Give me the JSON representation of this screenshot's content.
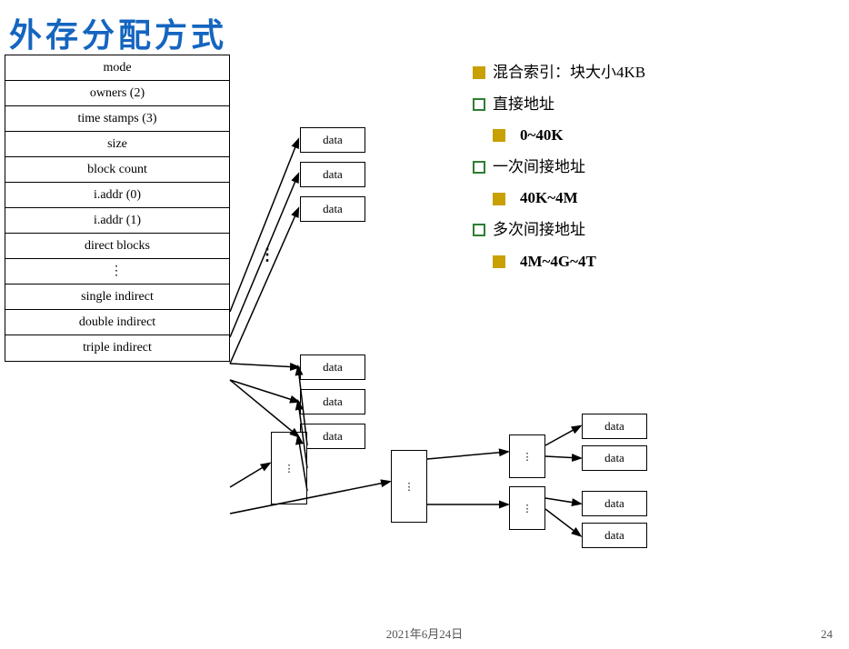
{
  "title": "外存分配方式",
  "inode_rows": [
    "mode",
    "owners (2)",
    "time stamps (3)",
    "size",
    "block count",
    "i.addr (0)",
    "i.addr (1)",
    "direct blocks",
    "⋮",
    "single indirect",
    "double indirect",
    "triple indirect"
  ],
  "data_label": "data",
  "dots_label": "⋮",
  "info": {
    "main_label": "混合索引：块大小4KB",
    "items": [
      {
        "type": "empty_square",
        "label": "直接地址"
      },
      {
        "type": "filled_square",
        "label": "0~40K"
      },
      {
        "type": "empty_square",
        "label": "一次间接地址"
      },
      {
        "type": "filled_square",
        "label": "40K~4M"
      },
      {
        "type": "empty_square",
        "label": "多次间接地址"
      },
      {
        "type": "filled_square",
        "label": "4M~4G~4T"
      }
    ]
  },
  "footer": {
    "date": "2021年6月24日",
    "page": "24"
  }
}
